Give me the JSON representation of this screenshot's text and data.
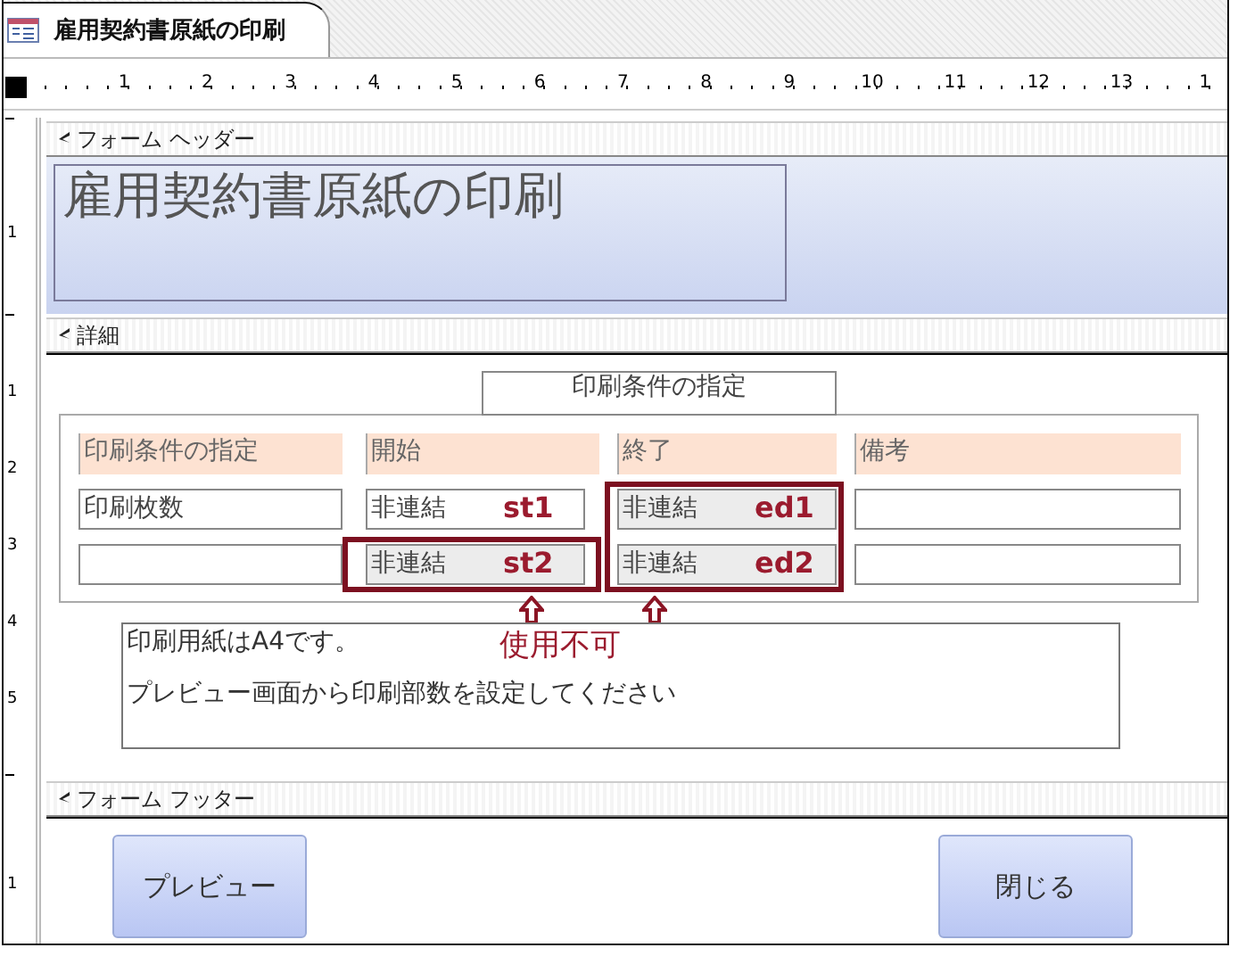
{
  "tab": {
    "title": "雇用契約書原紙の印刷"
  },
  "ruler": {
    "marks": [
      "1",
      "2",
      "3",
      "4",
      "5",
      "6",
      "7",
      "8",
      "9",
      "10",
      "11",
      "12",
      "13",
      "1"
    ]
  },
  "vertical_ruler": {
    "header": [
      "1"
    ],
    "detail": [
      "1",
      "2",
      "3",
      "4",
      "5"
    ],
    "footer": [
      "1"
    ]
  },
  "form_header": {
    "bar_label": "フォーム ヘッダー",
    "title": "雇用契約書原紙の印刷"
  },
  "detail": {
    "bar_label": "詳細",
    "group_title": "印刷条件の指定",
    "rows": [
      [
        {
          "kind": "label",
          "text": "印刷条件の指定"
        },
        {
          "kind": "label",
          "text": "開始"
        },
        {
          "kind": "label",
          "text": "終了"
        },
        {
          "kind": "label",
          "text": "備考"
        }
      ],
      [
        {
          "kind": "textbox",
          "text": "印刷枚数",
          "disabled": false,
          "highlighted": false
        },
        {
          "kind": "textbox",
          "text": "非連結",
          "tag": "st1",
          "disabled": false,
          "highlighted": false
        },
        {
          "kind": "textbox",
          "text": "非連結",
          "tag": "ed1",
          "disabled": true,
          "highlighted": true
        },
        {
          "kind": "textbox",
          "disabled": false,
          "highlighted": false
        }
      ],
      [
        {
          "kind": "textbox",
          "disabled": false,
          "highlighted": false
        },
        {
          "kind": "textbox",
          "text": "非連結",
          "tag": "st2",
          "disabled": true,
          "highlighted": true
        },
        {
          "kind": "textbox",
          "text": "非連結",
          "tag": "ed2",
          "disabled": true,
          "highlighted": true
        },
        {
          "kind": "textbox",
          "disabled": false,
          "highlighted": false
        }
      ]
    ],
    "callout": "使用不可",
    "note_lines": [
      "印刷用紙はA4です。",
      "プレビュー画面から印刷部数を設定してください"
    ]
  },
  "form_footer": {
    "bar_label": "フォーム フッター",
    "buttons": [
      {
        "label": "プレビュー"
      },
      {
        "label": "閉じる"
      }
    ]
  }
}
